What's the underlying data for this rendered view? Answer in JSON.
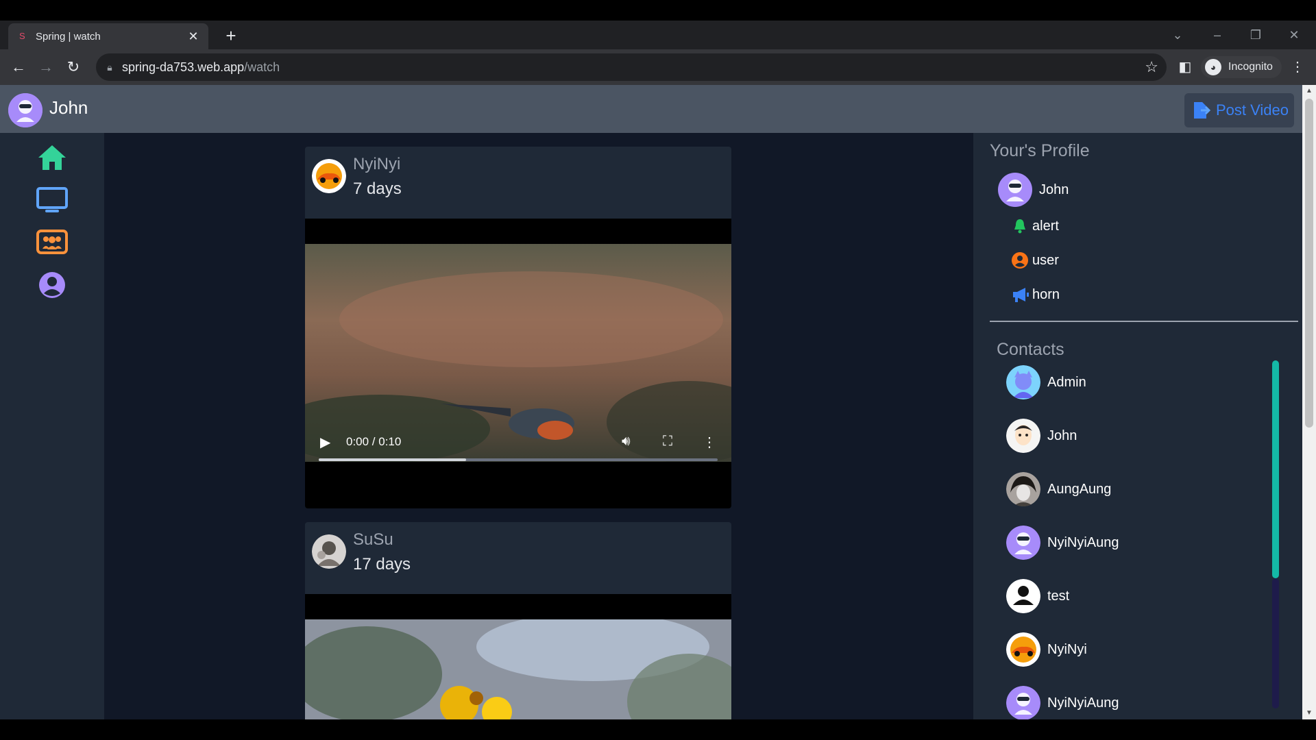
{
  "browser": {
    "tab_title": "Spring | watch",
    "url_host": "spring-da753.web.app",
    "url_path": "/watch",
    "incognito_label": "Incognito"
  },
  "header": {
    "username": "John",
    "post_button_label": "Post Video"
  },
  "left_nav": {
    "items": [
      {
        "icon": "home-icon",
        "color": "#34d399"
      },
      {
        "icon": "tv-icon",
        "color": "#60a5fa"
      },
      {
        "icon": "group-icon",
        "color": "#fb923c"
      },
      {
        "icon": "user-circle-icon",
        "color": "#a78bfa"
      }
    ]
  },
  "feed": {
    "posts": [
      {
        "author": "NyiNyi",
        "time": "7 days",
        "video_time": "0:00 / 0:10",
        "progress": 0.37
      },
      {
        "author": "SuSu",
        "time": "17 days"
      }
    ]
  },
  "profile_panel": {
    "title": "Your's Profile",
    "user": "John",
    "links": [
      {
        "label": "alert",
        "icon": "bell-icon",
        "color": "#22c55e"
      },
      {
        "label": "user",
        "icon": "user-circle-icon",
        "color": "#f97316"
      },
      {
        "label": "horn",
        "icon": "megaphone-icon",
        "color": "#3b82f6"
      }
    ]
  },
  "contacts": {
    "title": "Contacts",
    "items": [
      {
        "name": "Admin"
      },
      {
        "name": "John"
      },
      {
        "name": "AungAung"
      },
      {
        "name": "NyiNyiAung"
      },
      {
        "name": "test"
      },
      {
        "name": "NyiNyi"
      },
      {
        "name": "NyiNyiAung"
      }
    ]
  }
}
